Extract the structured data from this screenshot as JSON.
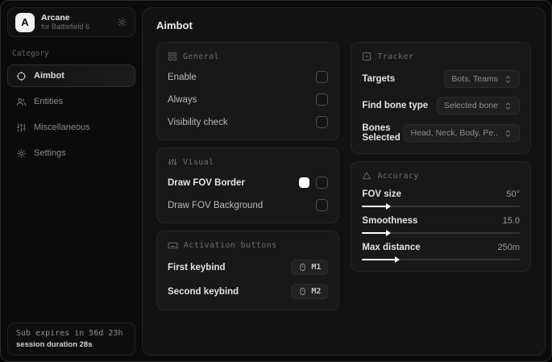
{
  "app": {
    "logo_letter": "A",
    "name": "Arcane",
    "subtitle": "for Battlefield 6"
  },
  "sidebar": {
    "category_label": "Category",
    "items": [
      {
        "label": "Aimbot",
        "icon": "crosshair-icon",
        "active": true
      },
      {
        "label": "Entities",
        "icon": "users-icon",
        "active": false
      },
      {
        "label": "Miscellaneous",
        "icon": "sliders-icon",
        "active": false
      },
      {
        "label": "Settings",
        "icon": "gear-icon",
        "active": false
      }
    ],
    "footer": {
      "line1": "Sub expires in 56d 23h",
      "line2": "session duration 28s"
    }
  },
  "main": {
    "title": "Aimbot",
    "general": {
      "title": "General",
      "rows": [
        {
          "label": "Enable",
          "checked": false
        },
        {
          "label": "Always",
          "checked": false
        },
        {
          "label": "Visibility check",
          "checked": false
        }
      ]
    },
    "visual": {
      "title": "Visual",
      "rows": [
        {
          "label": "Draw FOV Border",
          "color": "#ffffff",
          "checked": false
        },
        {
          "label": "Draw FOV Background",
          "checked": false
        }
      ]
    },
    "activation": {
      "title": "Activation buttons",
      "rows": [
        {
          "label": "First keybind",
          "key": "M1"
        },
        {
          "label": "Second keybind",
          "key": "M2"
        }
      ]
    },
    "tracker": {
      "title": "Tracker",
      "rows": [
        {
          "label": "Targets",
          "value": "Bots, Teams"
        },
        {
          "label": "Find bone type",
          "value": "Selected bone"
        },
        {
          "label": "Bones Selected",
          "value": "Head, Neck, Body, Pe.."
        }
      ]
    },
    "accuracy": {
      "title": "Accuracy",
      "sliders": [
        {
          "label": "FOV size",
          "value": "50°",
          "fill_pct": 15
        },
        {
          "label": "Smoothness",
          "value": "15.0",
          "fill_pct": 15
        },
        {
          "label": "Max distance",
          "value": "250m",
          "fill_pct": 21
        }
      ]
    }
  },
  "colors": {
    "accent": "#ffffff",
    "fov_border_swatch": "#ffffff",
    "window_bg": "#0b0b0b",
    "main_bg": "#121212",
    "card_bg": "#181818",
    "border": "#262626"
  }
}
